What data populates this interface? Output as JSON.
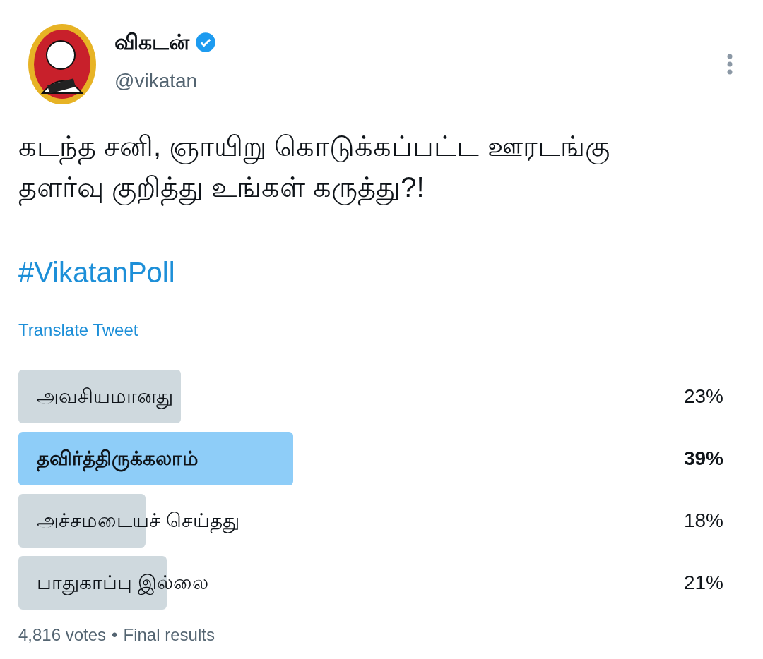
{
  "author": {
    "name": "விகடன்",
    "verified": true,
    "handle": "@vikatan"
  },
  "tweet": {
    "text": "கடந்த சனி, ஞாயிறு கொடுக்கப்பட்ட ஊரடங்கு தளர்வு குறித்து உங்கள் கருத்து?!",
    "hashtag": "#VikatanPoll",
    "translate": "Translate Tweet"
  },
  "poll": {
    "options": [
      {
        "label": "அவசியமானது",
        "percent": "23%",
        "leading": false
      },
      {
        "label": "தவிர்த்திருக்கலாம்",
        "percent": "39%",
        "leading": true
      },
      {
        "label": "அச்சமடையச் செய்தது",
        "percent": "18%",
        "leading": false
      },
      {
        "label": "பாதுகாப்பு இல்லை",
        "percent": "21%",
        "leading": false
      }
    ],
    "votes": "4,816 votes",
    "separator": "•",
    "status": "Final results"
  }
}
